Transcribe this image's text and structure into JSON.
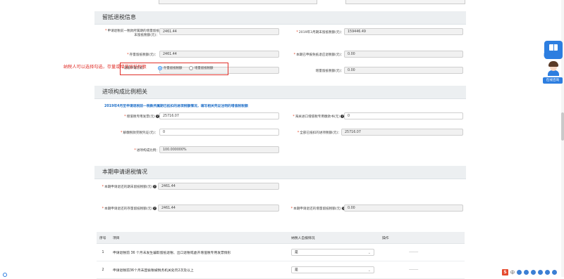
{
  "sections": {
    "retention": {
      "title": "留抵退税信息"
    },
    "proportion": {
      "title": "进项构成比例相关"
    },
    "application": {
      "title": "本期申请退税情况"
    }
  },
  "retention": {
    "f1_label": "申请退税前一税款所属期的增量留抵\n末留抵税额(元)：",
    "f1_value": "2461.44",
    "f2_label": "2019年3月期末留抵税额(元)：",
    "f2_value": "159446.49",
    "f3_label": "存量留抵税额(元)：",
    "f3_value": "2461.44",
    "f4_label": "本期已申报免抵退应退税额(元)：",
    "f4_value": "0.00",
    "f5_label": "增量留抵",
    "f5_value": "0.00"
  },
  "annotation": {
    "red_note": "纳税人可以选择勾选，存量或增量留抵税额",
    "radio_hint": "退税申请方式：",
    "radio1": "存量留抵税额",
    "radio2": "增量留抵税额",
    "radio_selected": "存量留抵税额"
  },
  "proportion": {
    "note": "2019年4月至申请退税前一税款所属期已抵扣的进项税额情况，填写相关凭证注明的增值税税额",
    "p1_label": "增值税专用发票(元)",
    "p1_value": "25716.07",
    "p2_label": "海关进口增值税专用缴款书(元)",
    "p2_value": "0",
    "p3_label": "解缴税款完税凭证(元)：",
    "p3_value": "0",
    "p4_label": "全部已抵扣的进项税额(元)：",
    "p4_value": "25716.07",
    "p5_label": "进项构成比例：",
    "p5_value": "100.000000%"
  },
  "application": {
    "a1_label": "本期申请退还的期末留抵税额(元)",
    "a1_value": "2461.44",
    "a2_label": "本期申请退还的存量留抵税额(元)",
    "a2_value": "2461.44",
    "a3_label": "本期申请退还的增量留抵税额(元)",
    "a3_value": "0.00"
  },
  "table": {
    "headers": [
      "序号",
      "项目",
      "纳税人自报情况",
      "操作"
    ],
    "rows": [
      {
        "no": "1",
        "item": "申请退税前 36 个月未发生骗取留抵退税、出口退税或虚开增值税专用发票情形",
        "answer": "是",
        "op": "———"
      },
      {
        "no": "2",
        "item": "申请退税前36个月未因偷税被税务机关处罚2次及以上",
        "answer": "是",
        "op": "———"
      }
    ]
  },
  "side_widgets": {
    "help_label": "操作指引",
    "agent_label": "在线咨询"
  },
  "toolbar": {
    "s_label": "S",
    "zh_label": "中"
  },
  "colors": {
    "accent": "#2d7ee0",
    "red": "#e0302a",
    "section_bg": "#eceff1"
  }
}
